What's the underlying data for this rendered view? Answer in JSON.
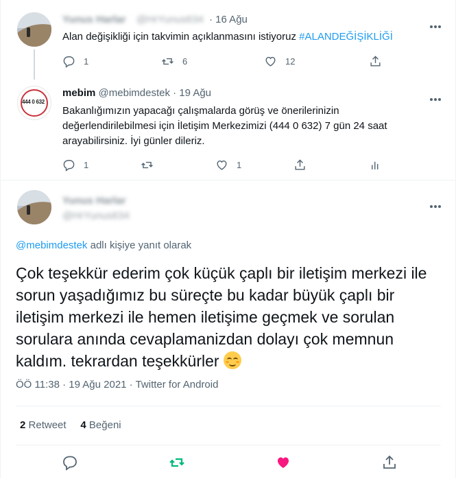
{
  "tweet1": {
    "name_blurred": "Yunus Harlar",
    "handle_blurred": "@HrYunus634",
    "time": "· 16 Ağu",
    "text": "Alan değişikliği için takvimin açıklanmasını istiyoruz",
    "hashtag": "#ALANDEĞİŞİKLİĞİ",
    "replies": "1",
    "retweets": "6",
    "likes": "12"
  },
  "tweet2": {
    "name": "mebim",
    "handle": "@mebimdestek",
    "time": "· 19 Ağu",
    "avatar_text": "444 0 632",
    "line1": "Bakanlığımızın yapacağı çalışmalarda görüş ve önerilerinizin",
    "line2": "değerlendirilebilmesi için İletişim Merkezimizi (444 0 632) 7 gün 24 saat",
    "line3": "arayabilirsiniz. İyi günler dileriz.",
    "replies": "1",
    "likes": "1"
  },
  "main": {
    "name_blurred": "Yunus Harlar",
    "handle_blurred": "@HrYunus634",
    "reply_to_link": "@mebimdestek",
    "reply_to_suffix": "adlı kişiye yanıt olarak",
    "text": "Çok teşekkür ederim çok küçük çaplı bir iletişim merkezi ile sorun yaşadığımız bu süreçte bu kadar büyük çaplı bir iletişim merkezi ile hemen iletişime geçmek ve sorulan sorulara anında cevaplamanizdan dolayı çok memnun kaldım. tekrardan teşekkürler",
    "meta": "ÖÖ 11:38 · 19 Ağu 2021 · Twitter for Android",
    "retweet_count": "2",
    "retweet_label": "Retweet",
    "like_count": "4",
    "like_label": "Beğeni"
  },
  "colors": {
    "accent": "#1d9bf0",
    "retweet": "#00ba7c",
    "like": "#f91880",
    "muted": "#536471"
  },
  "icons": [
    "more-icon",
    "reply-icon",
    "retweet-icon",
    "like-icon",
    "share-icon",
    "analytics-icon",
    "smiling-face-emoji"
  ]
}
